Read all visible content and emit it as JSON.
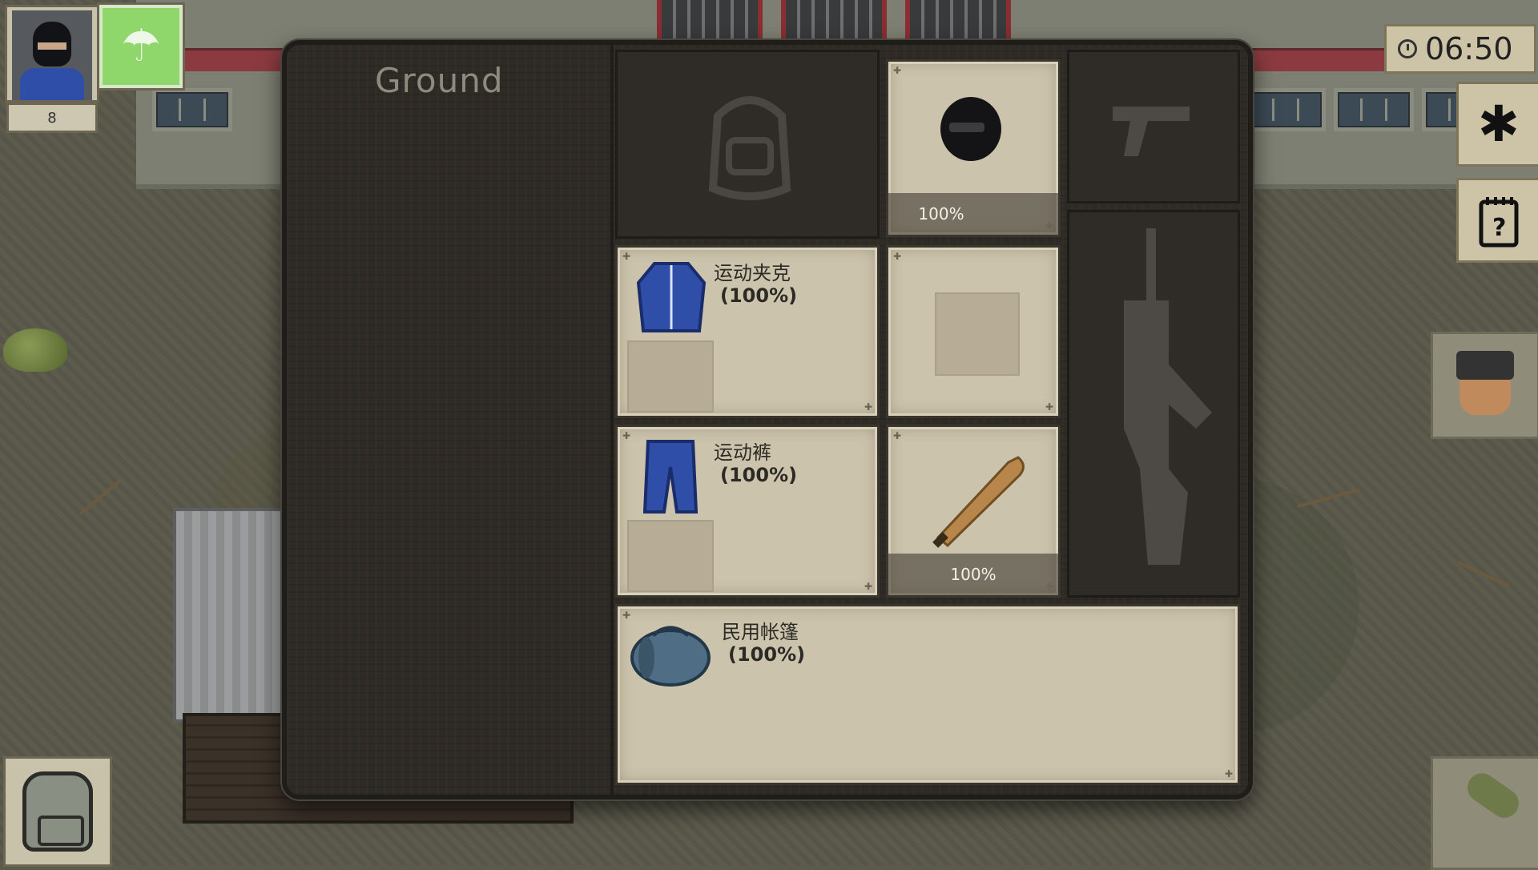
{
  "hud": {
    "character_level": "8",
    "status_icon": "umbrella-icon",
    "clock_time": "06:50",
    "settings_icon": "gear-icon",
    "journal_icon": "journal-icon"
  },
  "panel": {
    "title": "Ground",
    "slots": {
      "head": {
        "percent": "100%"
      },
      "jacket": {
        "name": "运动夹克",
        "percent": "(100%)"
      },
      "pants": {
        "name": "运动裤",
        "percent": "(100%)"
      },
      "melee": {
        "percent": "100%"
      },
      "tent": {
        "name": "民用帐篷",
        "percent": "(100%)"
      }
    }
  },
  "colors": {
    "panel_bg": "#2e2b27",
    "slot_bg": "#ccc3ac",
    "status_green": "#8fd76b",
    "jacket_blue": "#2f4ea8"
  }
}
